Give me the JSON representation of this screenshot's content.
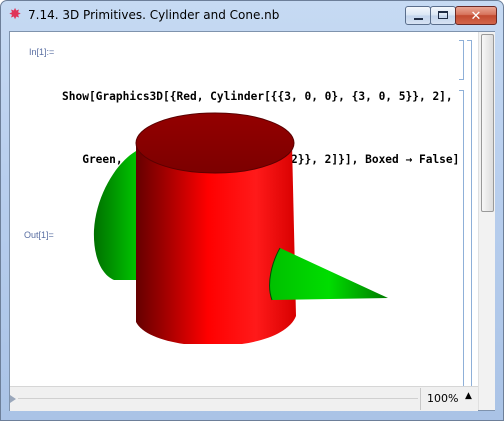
{
  "window": {
    "title": "7.14. 3D Primitives. Cylinder and Cone.nb",
    "controls": {
      "minimize": "minimize",
      "maximize": "maximize",
      "close": "✕"
    }
  },
  "notebook": {
    "input_label": "In[1]:=",
    "input_lines": [
      "Show[Graphics3D[{Red, Cylinder[{{3, 0, 0}, {3, 0, 5}}, 2],",
      "   Green, Cone[{{0, 0, 2}, {8, 0, 2}}, 2]}], Boxed → False]"
    ],
    "output_label": "Out[1]=",
    "graphic": {
      "objects": [
        "red-cylinder",
        "green-cone"
      ],
      "colors": {
        "cylinder": "#ff0000",
        "cone": "#00cc00"
      }
    }
  },
  "status": {
    "zoom": "100%",
    "zoom_arrow": "▲"
  },
  "colors": {
    "title_bar": "#b9cfee",
    "cell_label": "#5a6fa3",
    "bracket": "#8fb0d8"
  }
}
